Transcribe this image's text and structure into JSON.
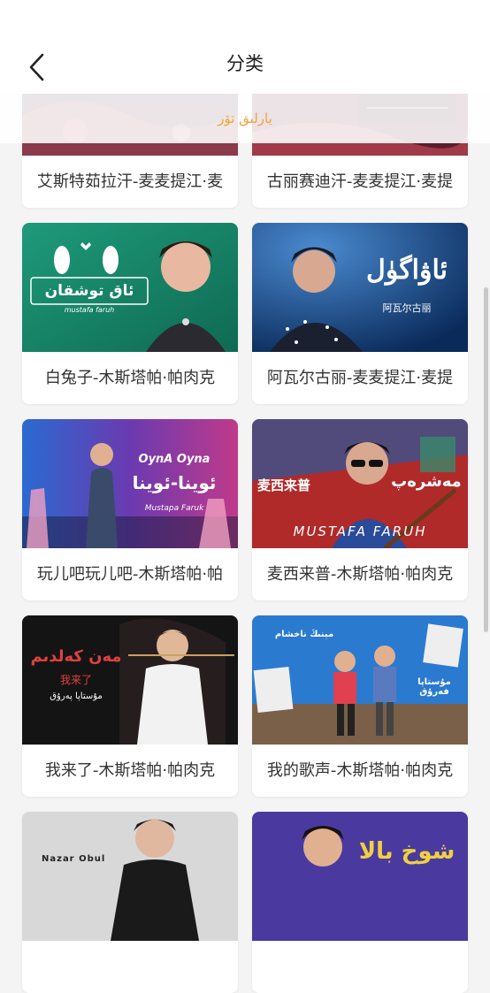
{
  "header": {
    "title": "分类",
    "back_icon": "chevron-left-icon"
  },
  "subtab": {
    "label": "يارلىق تۆر"
  },
  "videos": [
    {
      "caption": "艾斯特茹拉汗-麦麦提江·麦"
    },
    {
      "caption": "古丽赛迪汗-麦麦提江·麦提"
    },
    {
      "caption": "白兔子-木斯塔帕·帕肉克",
      "overlay": "ئاق توشقان",
      "overlay2": "mustafa faruh"
    },
    {
      "caption": "阿瓦尔古丽-麦麦提江·麦提",
      "overlay": "ئاۋاگۈل",
      "overlay2": "阿瓦尔古丽"
    },
    {
      "caption": "玩儿吧玩儿吧-木斯塔帕·帕",
      "overlay": "OynA Oyna",
      "overlay2": "ئوينا-ئوينا",
      "overlay3": "Mustapa Faruk"
    },
    {
      "caption": "麦西来普-木斯塔帕·帕肉克",
      "overlay": "麦西来普",
      "overlay2": "مەشرەپ",
      "overlay3": "MUSTAFA FARUH"
    },
    {
      "caption": "我来了-木斯塔帕·帕肉克",
      "overlay": "مەن كەلدىم",
      "overlay2": "我来了",
      "overlay3": "مۇستاپا پەرۇق"
    },
    {
      "caption": "我的歌声-木斯塔帕·帕肉克",
      "overlay": "مېنىڭ ناخشام",
      "overlay2": "مۇستاپا فەرۇق"
    },
    {
      "caption": "",
      "overlay": "Nazar Obul"
    },
    {
      "caption": "",
      "overlay": "شوخ بالا"
    }
  ]
}
